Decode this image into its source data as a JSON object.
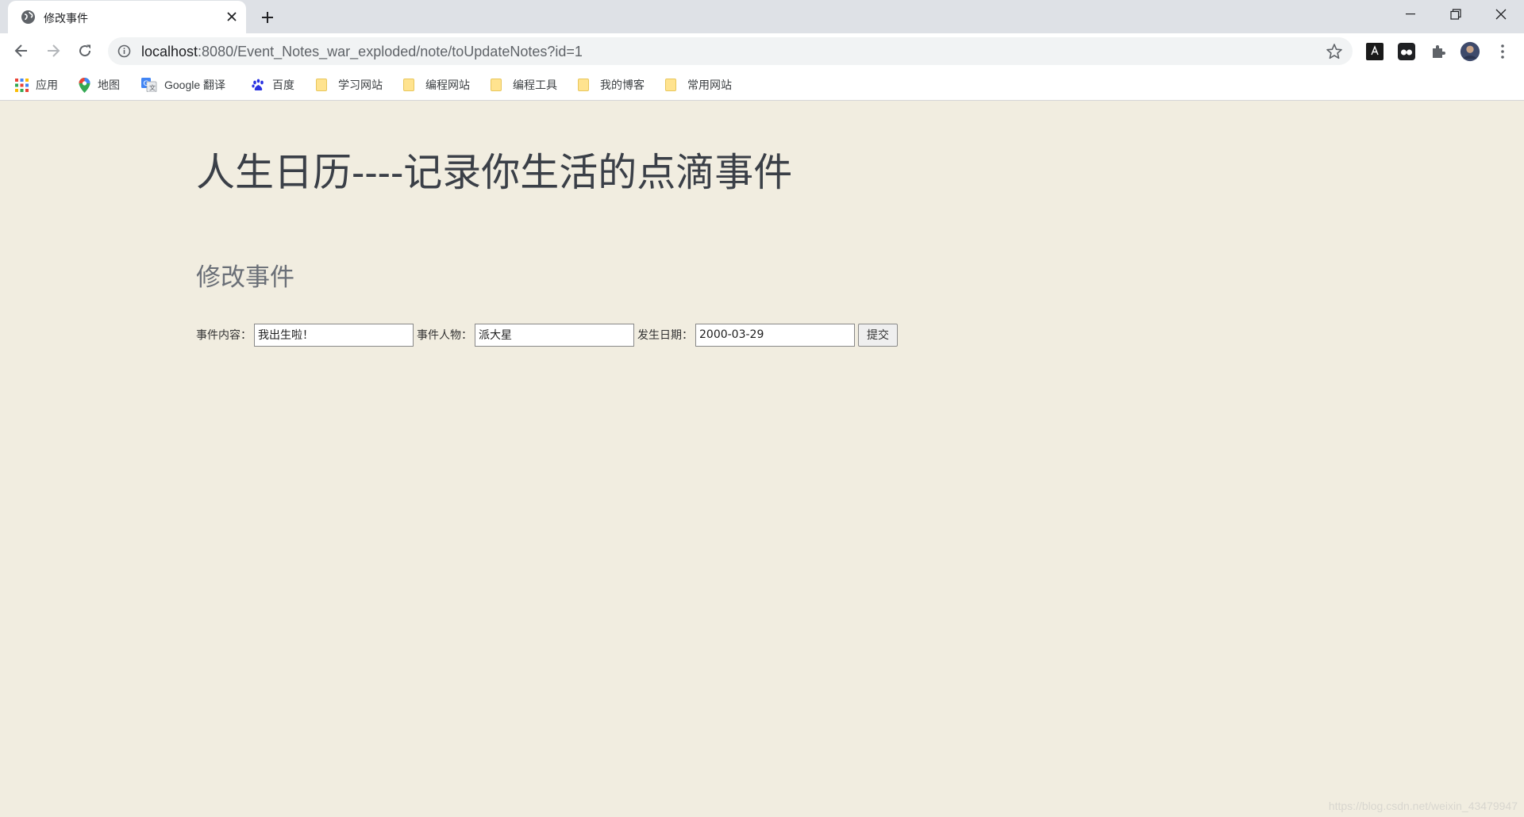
{
  "browser": {
    "tab_title": "修改事件",
    "url_host": "localhost",
    "url_rest": ":8080/Event_Notes_war_exploded/note/toUpdateNotes?id=1",
    "bookmarks": [
      {
        "label": "应用",
        "icon": "apps-grid-icon"
      },
      {
        "label": "地图",
        "icon": "maps-pin-icon"
      },
      {
        "label": "Google 翻译",
        "icon": "translate-icon"
      },
      {
        "label": "百度",
        "icon": "baidu-paw-icon"
      },
      {
        "label": "学习网站",
        "icon": "folder-icon"
      },
      {
        "label": "编程网站",
        "icon": "folder-icon"
      },
      {
        "label": "编程工具",
        "icon": "folder-icon"
      },
      {
        "label": "我的博客",
        "icon": "folder-icon"
      },
      {
        "label": "常用网站",
        "icon": "folder-icon"
      }
    ]
  },
  "page": {
    "title": "人生日历----记录你生活的点滴事件",
    "section_title": "修改事件",
    "form": {
      "content_label": "事件内容：",
      "content_value": "我出生啦！",
      "person_label": "事件人物：",
      "person_value": "派大星",
      "date_label": "发生日期：",
      "date_value": "2000-03-29",
      "submit_label": "提交"
    },
    "watermark": "https://blog.csdn.net/weixin_43479947"
  },
  "colors": {
    "page_background": "#f1ede0",
    "title_text": "#3a3f47"
  }
}
